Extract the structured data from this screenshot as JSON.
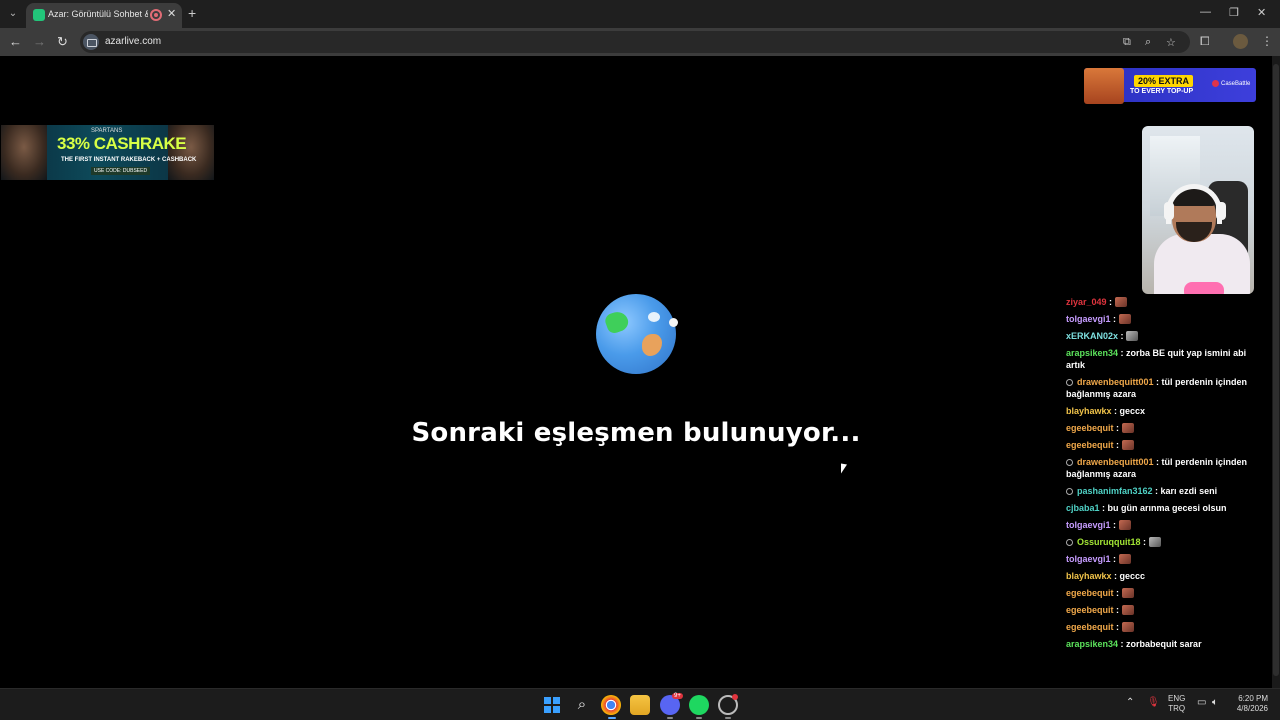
{
  "browser": {
    "tab_title": "Azar: Görüntülü Sohbet & Y",
    "url": "azarlive.com"
  },
  "page": {
    "status_text": "Sonraki eşleşmen bulunuyor..."
  },
  "ads": {
    "left": {
      "brand": "SPARTANS",
      "headline": "33% CASHRAKE",
      "sub": "THE FIRST INSTANT RAKEBACK + CASHBACK",
      "cta": "USE CODE: DUBSEED"
    },
    "right": {
      "pill": "20% EXTRA",
      "line": "TO EVERY TOP-UP",
      "logo": "CaseBattle"
    }
  },
  "chat": {
    "messages": [
      {
        "user": "ziyar_049",
        "text": "",
        "emote": true,
        "color": "#e0343e",
        "badge": false
      },
      {
        "user": "tolgaevgi1",
        "text": "",
        "emote": true,
        "color": "#c69cff",
        "badge": false
      },
      {
        "user": "xERKAN02x",
        "text": "",
        "emote": true,
        "emote_grey": true,
        "color": "#7ee0e0",
        "badge": false
      },
      {
        "user": "arapsiken34",
        "text": "zorba BE quit yap ismini abi artık",
        "emote": false,
        "color": "#5ce35c",
        "badge": false
      },
      {
        "user": "drawenbequitt001",
        "text": "tül perdenin içinden bağlanmış azara",
        "emote": false,
        "color": "#f0a84a",
        "badge": true
      },
      {
        "user": "blayhawkx",
        "text": "geccx",
        "emote": false,
        "color": "#f0c34a",
        "badge": false
      },
      {
        "user": "egeebequit",
        "text": "",
        "emote": true,
        "color": "#f0a84a",
        "badge": false
      },
      {
        "user": "egeebequit",
        "text": "",
        "emote": true,
        "color": "#f0a84a",
        "badge": false
      },
      {
        "user": "drawenbequitt001",
        "text": "tül perdenin içinden bağlanmış azara",
        "emote": false,
        "color": "#f0a84a",
        "badge": true
      },
      {
        "user": "pashanimfan3162",
        "text": "karı ezdi seni",
        "emote": false,
        "color": "#4fd1c5",
        "badge": true
      },
      {
        "user": "cjbaba1",
        "text": "bu gün arınma gecesi olsun",
        "emote": false,
        "color": "#4fd1c5",
        "badge": false
      },
      {
        "user": "tolgaevgi1",
        "text": "",
        "emote": true,
        "color": "#c69cff",
        "badge": false
      },
      {
        "user": "Ossuruqquit18",
        "text": "",
        "emote": true,
        "emote_grey": true,
        "color": "#a3e635",
        "badge": true
      },
      {
        "user": "tolgaevgi1",
        "text": "",
        "emote": true,
        "color": "#c69cff",
        "badge": false
      },
      {
        "user": "blayhawkx",
        "text": "geccc",
        "emote": false,
        "color": "#f0c34a",
        "badge": false
      },
      {
        "user": "egeebequit",
        "text": "",
        "emote": true,
        "color": "#f0a84a",
        "badge": false
      },
      {
        "user": "egeebequit",
        "text": "",
        "emote": true,
        "color": "#f0a84a",
        "badge": false
      },
      {
        "user": "egeebequit",
        "text": "",
        "emote": true,
        "color": "#f0a84a",
        "badge": false
      },
      {
        "user": "arapsiken34",
        "text": "zorbabequit sarar",
        "emote": false,
        "color": "#5ce35c",
        "badge": false
      }
    ]
  },
  "taskbar": {
    "discord_badge": "9+",
    "lang_top": "ENG",
    "lang_bottom": "TRQ",
    "time": "6:20 PM",
    "date": "4/8/2026"
  },
  "icons": {
    "tab_menu": "chevron-down-icon",
    "back": "arrow-left-icon",
    "forward": "arrow-right-icon",
    "reload": "reload-icon"
  }
}
